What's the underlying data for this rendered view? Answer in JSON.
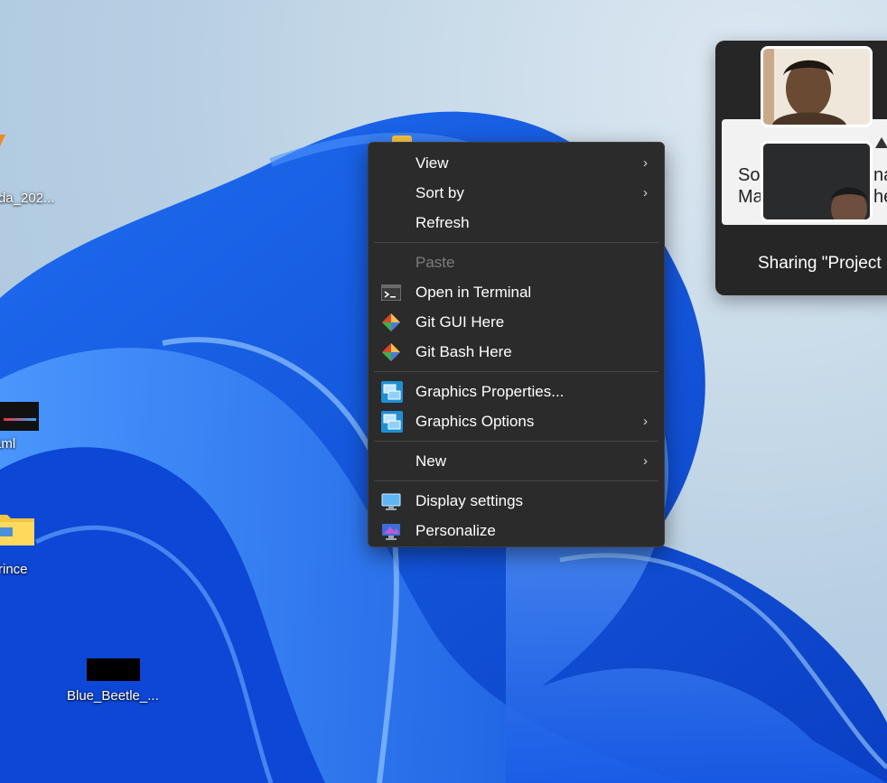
{
  "desktop": {
    "icons": [
      {
        "label": "da_202..."
      },
      {
        "label": "i&ml"
      },
      {
        "label": "rince"
      },
      {
        "label": "Blue_Beetle_..."
      }
    ]
  },
  "context_menu": {
    "items": [
      {
        "label": "View",
        "icon": "none",
        "submenu": true
      },
      {
        "label": "Sort by",
        "icon": "none",
        "submenu": true
      },
      {
        "label": "Refresh",
        "icon": "none"
      },
      {
        "label": "Paste",
        "icon": "none",
        "disabled": true
      },
      {
        "label": "Open in Terminal",
        "icon": "terminal-icon"
      },
      {
        "label": "Git GUI Here",
        "icon": "git-icon"
      },
      {
        "label": "Git Bash Here",
        "icon": "git-icon"
      },
      {
        "label": "Graphics Properties...",
        "icon": "intel-graphics-icon"
      },
      {
        "label": "Graphics Options",
        "icon": "intel-graphics-icon",
        "submenu": true
      },
      {
        "label": "New",
        "icon": "none",
        "submenu": true
      },
      {
        "label": "Display settings",
        "icon": "display-icon"
      },
      {
        "label": "Personalize",
        "icon": "personalize-icon"
      }
    ],
    "chevron": "›"
  },
  "share_panel": {
    "card_text_left": "So\nMa",
    "card_text_right": "na\nhe",
    "sharing_label": "Sharing \"Project"
  }
}
